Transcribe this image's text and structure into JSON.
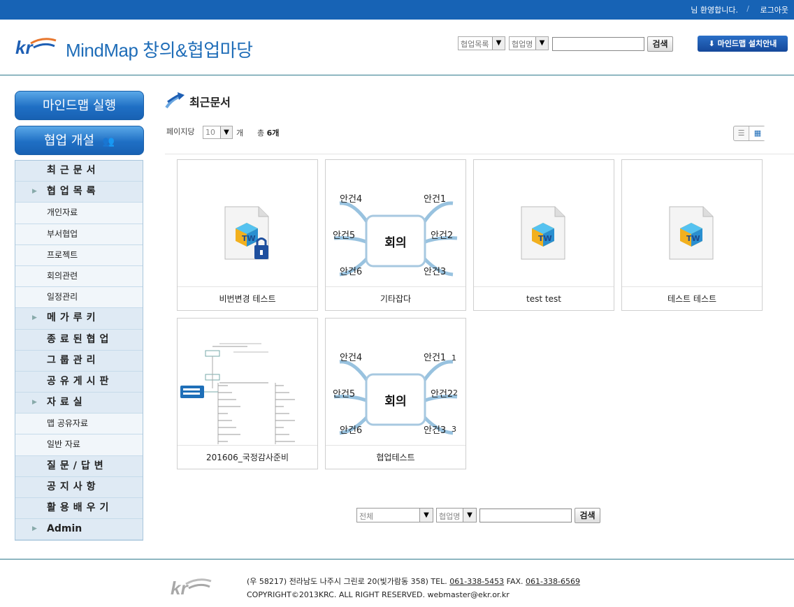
{
  "topbar": {
    "greeting": "님 환영합니다.",
    "separator": "/",
    "logout": "로그아웃"
  },
  "header": {
    "title": "MindMap 창의&협업마당",
    "category_select": "협업목록",
    "field_select": "협업명",
    "search_value": "",
    "search_button": "검색",
    "install_button": "마인드맵 설치안내"
  },
  "sidebar": {
    "run_button": "마인드맵 실행",
    "open_button": "협업 개설",
    "menu": [
      {
        "label": "최근문서",
        "type": "main",
        "arrow": false
      },
      {
        "label": "협업목록",
        "type": "main",
        "arrow": true
      },
      {
        "label": "개인자료",
        "type": "sub"
      },
      {
        "label": "부서협업",
        "type": "sub"
      },
      {
        "label": "프로젝트",
        "type": "sub"
      },
      {
        "label": "회의관련",
        "type": "sub"
      },
      {
        "label": "일정관리",
        "type": "sub"
      },
      {
        "label": "메가루키",
        "type": "main",
        "arrow": true
      },
      {
        "label": "종료된협업",
        "type": "main",
        "arrow": false
      },
      {
        "label": "그룹관리",
        "type": "main",
        "arrow": false
      },
      {
        "label": "공유게시판",
        "type": "main",
        "arrow": false
      },
      {
        "label": "자료실",
        "type": "main",
        "arrow": true
      },
      {
        "label": "맵 공유자료",
        "type": "sub"
      },
      {
        "label": "일반 자료",
        "type": "sub"
      },
      {
        "label": "질문/답변",
        "type": "main",
        "arrow": false
      },
      {
        "label": "공지사항",
        "type": "main",
        "arrow": false
      },
      {
        "label": "활용배우기",
        "type": "main",
        "arrow": false
      },
      {
        "label": "Admin",
        "type": "main",
        "arrow": true
      }
    ]
  },
  "main": {
    "heading": "최근문서",
    "per_page_label": "페이지당",
    "per_page_value": "10",
    "per_page_unit": "개",
    "total_label": "총",
    "total_count": "6개",
    "documents": [
      {
        "title": "비번변경 테스트",
        "thumb": "locked-file-icon"
      },
      {
        "title": "기타잡다",
        "thumb": "meeting-mindmap"
      },
      {
        "title": "test test",
        "thumb": "file-icon"
      },
      {
        "title": "테스트 테스트",
        "thumb": "file-icon"
      },
      {
        "title": "201606_국정감사준비",
        "thumb": "tree-mindmap"
      },
      {
        "title": "협업테스트",
        "thumb": "meeting-mindmap-numbered"
      }
    ],
    "mindmap": {
      "center": "회의",
      "topics": [
        "안건4",
        "안건1",
        "안건5",
        "안건2",
        "안건6",
        "안건3"
      ],
      "numbers": [
        "1",
        "2",
        "3"
      ]
    }
  },
  "bottom_search": {
    "scope_select": "전체",
    "field_select": "협업명",
    "search_value": "",
    "search_button": "검색"
  },
  "footer": {
    "address": "(우 58217) 전라남도 나주시 그린로 20(빛가람동 358)  TEL.",
    "tel": "061-338-5453",
    "fax_label": "FAX.",
    "fax": "061-338-6569",
    "copyright": "COPYRIGHT©2013KRC. ALL RIGHT RESERVED. webmaster@ekr.or.kr"
  },
  "colors": {
    "topbar": "#1763b5",
    "accent": "#1f6db8",
    "menu_bg": "#dfeaf4"
  }
}
